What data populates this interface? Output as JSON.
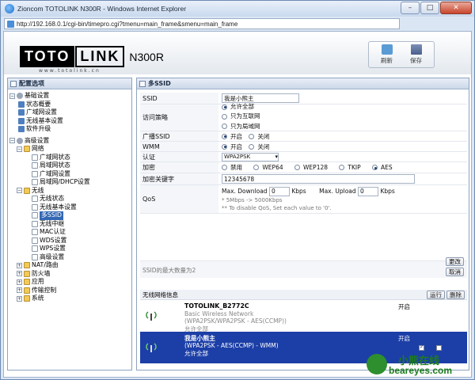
{
  "window": {
    "title": "Zioncom TOTOLINK N300R - Windows Internet Explorer",
    "address": "http://192.168.0.1/cgi-bin/timepro.cgi?tmenu=main_frame&smenu=main_frame"
  },
  "header": {
    "logo_left": "TOTO",
    "logo_right": "LINK",
    "model": "N300R",
    "url": "www.totolink.cn",
    "refresh": "刷新",
    "save": "保存"
  },
  "sidebar": {
    "title": "配置选项",
    "items": [
      {
        "label": "基础设置"
      },
      {
        "label": "状态概要"
      },
      {
        "label": "广域网设置"
      },
      {
        "label": "无线基本设置"
      },
      {
        "label": "软件升级"
      },
      {
        "label": "高级设置"
      },
      {
        "label": "网络"
      },
      {
        "label": "广域网状态"
      },
      {
        "label": "局域网状态"
      },
      {
        "label": "广域网设置"
      },
      {
        "label": "局域网/DHCP设置"
      },
      {
        "label": "无线"
      },
      {
        "label": "无线状态"
      },
      {
        "label": "无线基本设置"
      },
      {
        "label": "多SSID"
      },
      {
        "label": "无线中继"
      },
      {
        "label": "MAC认证"
      },
      {
        "label": "WDS设置"
      },
      {
        "label": "WPS设置"
      },
      {
        "label": "高级设置"
      },
      {
        "label": "NAT/路由"
      },
      {
        "label": "防火墙"
      },
      {
        "label": "应用"
      },
      {
        "label": "传输控制"
      },
      {
        "label": "系统"
      }
    ]
  },
  "main": {
    "title": "多SSID",
    "ssid_label": "SSID",
    "ssid_value": "我是小熊主",
    "policy_label": "访问策略",
    "policy_opts": [
      "允许全部",
      "只为互联网",
      "只为局域网"
    ],
    "broadcast_label": "广播SSID",
    "on": "开启",
    "off": "关闭",
    "wmm_label": "WMM",
    "auth_label": "认证",
    "auth_value": "WPA2PSK",
    "enc_label": "加密",
    "enc_opts": [
      "禁用",
      "WEP64",
      "WEP128",
      "TKIP",
      "AES"
    ],
    "key_label": "加密关键字",
    "key_value": "12345678",
    "qos_label": "QoS",
    "max_down": "Max. Download",
    "max_up": "Max. Upload",
    "down_val": "0",
    "up_val": "0",
    "kbps": "Kbps",
    "qos_note1": "* 5Mbps -> 5000Kbps",
    "qos_note2": "** To disable QoS, Set each value to '0'.",
    "limit_text": "SSID的最大数量为2",
    "change_btn": "更改",
    "cancel_btn": "取消",
    "list_title": "无线网络信息",
    "run_btn": "运行",
    "delete_btn": "删除",
    "entries": [
      {
        "name": "TOTOLINK_B2772C",
        "l2": "Basic Wireless Network",
        "l3": "(WPA2PSK/WPA2PSK - AES(CCMP))",
        "l4": "允许全部",
        "status": "开启"
      },
      {
        "name": "我是小熊主",
        "l2": "(WPA2PSK - AES(CCMP) - WMM)",
        "l3": "允许全部",
        "status": "开启"
      }
    ]
  },
  "watermark": {
    "zh": "小熊在线",
    "en": "beareyes.com"
  }
}
